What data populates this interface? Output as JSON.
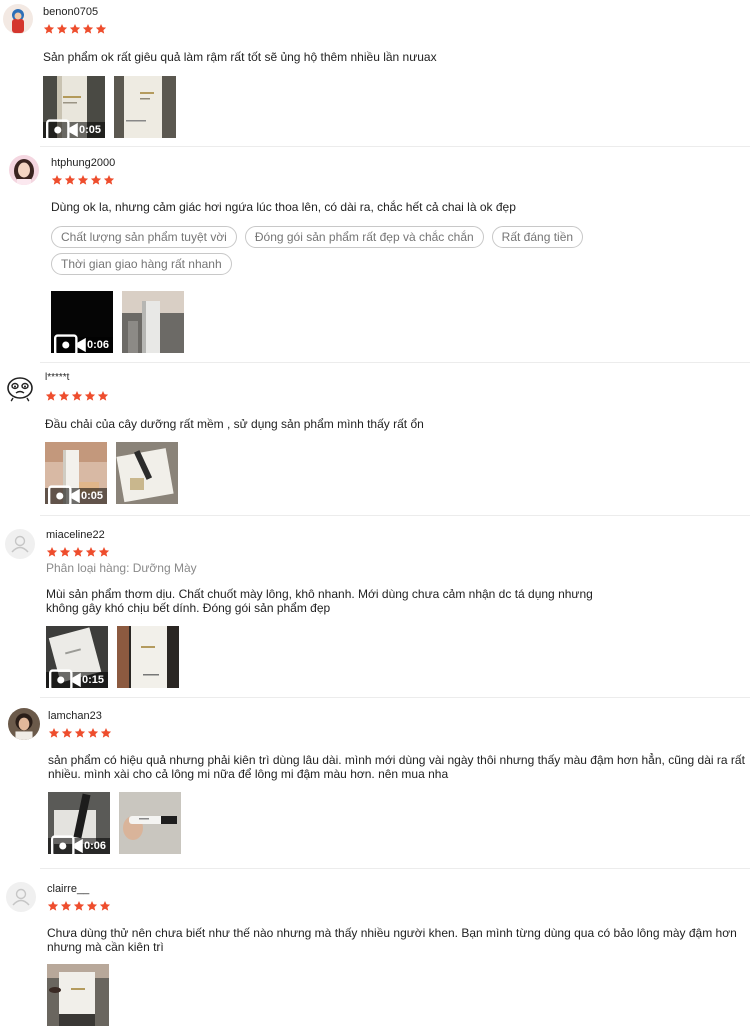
{
  "colors": {
    "star": "#ee4d2d",
    "tag_border": "#c8c8c8",
    "muted": "#8a8a8a"
  },
  "reviews": [
    {
      "username": "benon0705",
      "rating": 5,
      "comment": "Sản phẩm ok rất giêu quả làm rậm rất tốt sẽ ủng hộ thêm nhiều lần nưuax",
      "media": [
        {
          "type": "video",
          "duration": "0:05"
        },
        {
          "type": "image"
        }
      ]
    },
    {
      "username": "htphung2000",
      "rating": 5,
      "comment": "Dùng ok la, nhưng cảm giác hơi ngứa lúc thoa lên, có dài ra, chắc hết cả chai là ok đẹp",
      "tags": [
        "Chất lượng sản phẩm tuyệt vời",
        "Đóng gói sản phẩm rất đẹp và chắc chắn",
        "Rất đáng tiền",
        "Thời gian giao hàng rất nhanh"
      ],
      "media": [
        {
          "type": "video",
          "duration": "0:06"
        },
        {
          "type": "image"
        }
      ]
    },
    {
      "username": "l*****t",
      "rating": 5,
      "comment": "Đầu chải của cây dưỡng rất mềm , sử dụng sản phẩm mình thấy rất ổn",
      "media": [
        {
          "type": "video",
          "duration": "0:05"
        },
        {
          "type": "image"
        }
      ]
    },
    {
      "username": "miaceline22",
      "rating": 5,
      "variation": "Phân loại hàng: Dưỡng Mày",
      "comment": "Mùi sản phẩm thơm dịu. Chất chuốt mày lông, khô nhanh. Mới dùng chưa cảm nhận dc tá dụng nhưng\nkhông gây khó chịu bết dính. Đóng gói sản phẩm đẹp",
      "media": [
        {
          "type": "video",
          "duration": "0:15"
        },
        {
          "type": "image"
        }
      ]
    },
    {
      "username": "lamchan23",
      "rating": 5,
      "comment": "sản phẩm có hiệu quả nhưng phải kiên trì dùng lâu dài. mình mới dùng vài ngày thôi nhưng thấy màu đậm hơn hẳn, cũng dài ra rất\nnhiều. mình xài cho cả lông mi nữa để lông mi đậm màu hơn. nên mua nha",
      "media": [
        {
          "type": "video",
          "duration": "0:06"
        },
        {
          "type": "image"
        }
      ]
    },
    {
      "username": "clairre__",
      "rating": 5,
      "comment": "Chưa dùng thử nên chưa biết như thế nào nhưng mà thấy nhiều người khen. Bạn mình từng dùng qua có bảo lông mày đậm hơn\nnhưng mà cần kiên trì",
      "media": [
        {
          "type": "image"
        }
      ]
    }
  ]
}
